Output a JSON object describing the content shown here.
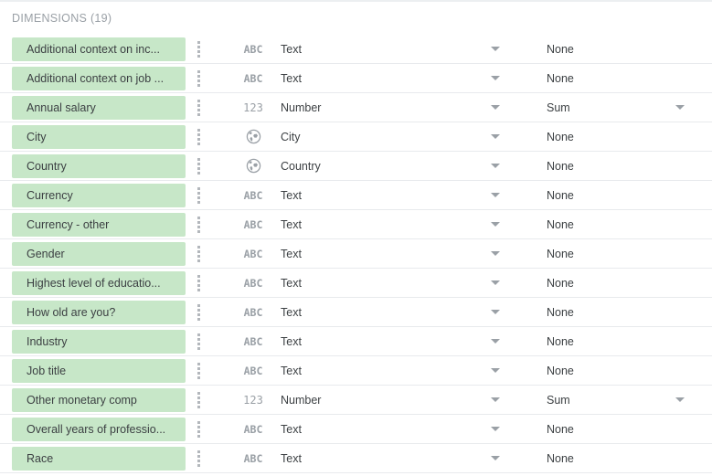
{
  "section": {
    "title": "DIMENSIONS (19)",
    "chip_color": "#c7e7c8",
    "row_divider_color": "#e8eaed",
    "muted_text_color": "#9aa0a6",
    "text_color": "#3c4043"
  },
  "icons": {
    "drag_handle": "drag-handle-icon",
    "text_type": "abc-icon",
    "number_type": "123-icon",
    "geo_type": "globe-icon",
    "caret": "chevron-down-icon"
  },
  "glyphs": {
    "abc": "ABC",
    "num": "123"
  },
  "fields": [
    {
      "name": "Additional context on inc...",
      "icon": "abc",
      "type": "Text",
      "agg": "None",
      "agg_caret": false
    },
    {
      "name": "Additional context on job ...",
      "icon": "abc",
      "type": "Text",
      "agg": "None",
      "agg_caret": false
    },
    {
      "name": "Annual salary",
      "icon": "num",
      "type": "Number",
      "agg": "Sum",
      "agg_caret": true
    },
    {
      "name": "City",
      "icon": "geo",
      "type": "City",
      "agg": "None",
      "agg_caret": false
    },
    {
      "name": "Country",
      "icon": "geo",
      "type": "Country",
      "agg": "None",
      "agg_caret": false
    },
    {
      "name": "Currency",
      "icon": "abc",
      "type": "Text",
      "agg": "None",
      "agg_caret": false
    },
    {
      "name": "Currency - other",
      "icon": "abc",
      "type": "Text",
      "agg": "None",
      "agg_caret": false
    },
    {
      "name": "Gender",
      "icon": "abc",
      "type": "Text",
      "agg": "None",
      "agg_caret": false
    },
    {
      "name": "Highest level of educatio...",
      "icon": "abc",
      "type": "Text",
      "agg": "None",
      "agg_caret": false
    },
    {
      "name": "How old are you?",
      "icon": "abc",
      "type": "Text",
      "agg": "None",
      "agg_caret": false
    },
    {
      "name": "Industry",
      "icon": "abc",
      "type": "Text",
      "agg": "None",
      "agg_caret": false
    },
    {
      "name": "Job title",
      "icon": "abc",
      "type": "Text",
      "agg": "None",
      "agg_caret": false
    },
    {
      "name": "Other monetary comp",
      "icon": "num",
      "type": "Number",
      "agg": "Sum",
      "agg_caret": true
    },
    {
      "name": "Overall years of professio...",
      "icon": "abc",
      "type": "Text",
      "agg": "None",
      "agg_caret": false
    },
    {
      "name": "Race",
      "icon": "abc",
      "type": "Text",
      "agg": "None",
      "agg_caret": false
    }
  ]
}
